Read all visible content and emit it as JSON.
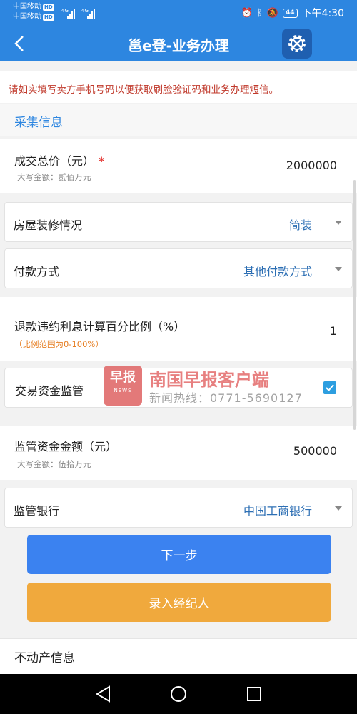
{
  "status_bar": {
    "carrier1": "中国移动",
    "carrier2": "中国移动",
    "hd_badge": "HD",
    "network": "4G",
    "battery": "44",
    "time": "下午4:30"
  },
  "app_bar": {
    "title": "邕e登-业务办理"
  },
  "notice": "请如实填写卖方手机号码以便获取刷脸验证码和业务办理短信。",
  "section_collect": "采集信息",
  "fields": {
    "total_price": {
      "label": "成交总价（元）",
      "required_mark": "*",
      "sub_label": "大写金额：贰佰万元",
      "value": "2000000"
    },
    "decoration": {
      "label": "房屋装修情况",
      "value": "简装"
    },
    "payment": {
      "label": "付款方式",
      "value": "其他付款方式"
    },
    "refund_ratio": {
      "label": "退款违约利息计算百分比例（%）",
      "hint": "（比例范围为0-100%）",
      "value": "1"
    },
    "fund_supervision": {
      "label": "交易资金监管",
      "checked": true
    },
    "supervised_amount": {
      "label": "监管资金金额（元）",
      "sub_label": "大写金额：伍拾万元",
      "value": "500000"
    },
    "supervising_bank": {
      "label": "监管银行",
      "value": "中国工商银行"
    }
  },
  "buttons": {
    "next": "下一步",
    "enter_agent": "录入经纪人"
  },
  "section_property": "不动产信息",
  "watermark": {
    "logo_text": "早报",
    "logo_sub": "NEWS",
    "title": "南国早报客户端",
    "hotline": "新闻热线：0771-5690127"
  },
  "colors": {
    "primary": "#2d86e0",
    "warning": "#c0392b",
    "next_button": "#3b82f0",
    "agent_button": "#f0a93d"
  }
}
